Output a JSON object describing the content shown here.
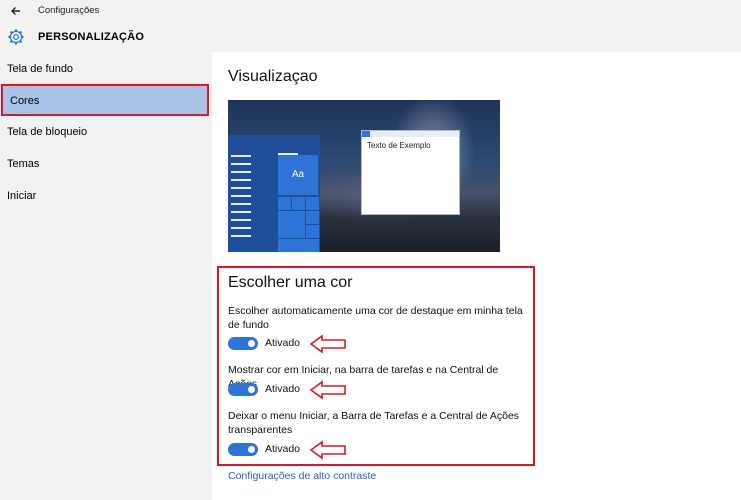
{
  "window": {
    "app_title": "Configurações"
  },
  "header": {
    "section_title": "PERSONALIZAÇÃO"
  },
  "sidebar": {
    "items": [
      {
        "label": "Tela de fundo"
      },
      {
        "label": "Cores",
        "selected": true
      },
      {
        "label": "Tela de bloqueio"
      },
      {
        "label": "Temas"
      },
      {
        "label": "Iniciar"
      }
    ]
  },
  "preview": {
    "heading": "Visualizaçao",
    "tile_label": "Aa",
    "window_text": "Texto de Exemplo"
  },
  "color": {
    "heading": "Escolher uma cor",
    "options": [
      {
        "description": "Escolher automaticamente uma cor de destaque em minha tela de fundo",
        "state": "Ativado",
        "on": true
      },
      {
        "description": "Mostrar cor em Iniciar, na barra de tarefas e na Central de Ações",
        "state": "Ativado",
        "on": true
      },
      {
        "description": "Deixar o menu Iniciar, a Barra de Tarefas e a Central de Ações transparentes",
        "state": "Ativado",
        "on": true
      }
    ],
    "high_contrast_link": "Configurações de alto contraste"
  },
  "colors": {
    "accent": "#2e74d6",
    "highlight": "#d9192a",
    "selected_nav": "#a9c4e8",
    "link": "#2a64b8"
  },
  "icons": [
    "back-arrow-icon",
    "gear-icon",
    "red-arrow-icon"
  ]
}
